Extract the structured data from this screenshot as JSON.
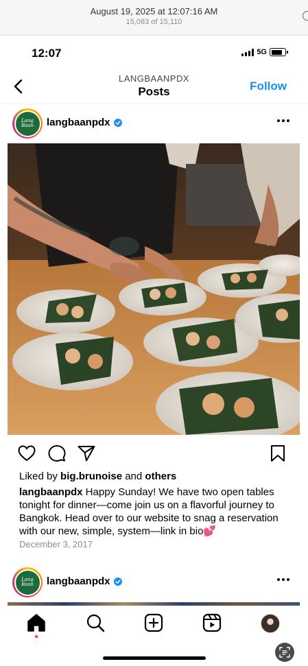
{
  "viewer": {
    "title": "August 19, 2025 at 12:07:16 AM",
    "counter": "15,083 of 15,110"
  },
  "status_bar": {
    "time": "12:07",
    "network": "5G"
  },
  "header": {
    "username": "LANGBAANPDX",
    "title": "Posts",
    "follow_label": "Follow"
  },
  "post": {
    "avatar_text": "Lang Baan",
    "username": "langbaanpdx",
    "verified": true,
    "photo_alt": "Chef plating small bites on banana leaves over white ceramic plates",
    "liked_prefix": "Liked by ",
    "liked_user": "big.brunoise",
    "liked_mid": " and ",
    "liked_others": "others",
    "caption_user": "langbaanpdx",
    "caption_text": " Happy Sunday! We have two open tables tonight for dinner—come join us on a flavorful journey to Bangkok. Head over to our website to snag a reservation with our new, simple, system—link in bio💕",
    "date": "December 3, 2017"
  },
  "next_post": {
    "avatar_text": "Lang Baan",
    "username": "langbaanpdx",
    "verified": true
  },
  "tabbar": {
    "items": [
      "home-icon",
      "search-icon",
      "create-icon",
      "reels-icon",
      "profile-avatar"
    ]
  },
  "colors": {
    "accent": "#1a8ff0",
    "verified": "#1a8ff0",
    "brand_green": "#1e6b3a"
  }
}
